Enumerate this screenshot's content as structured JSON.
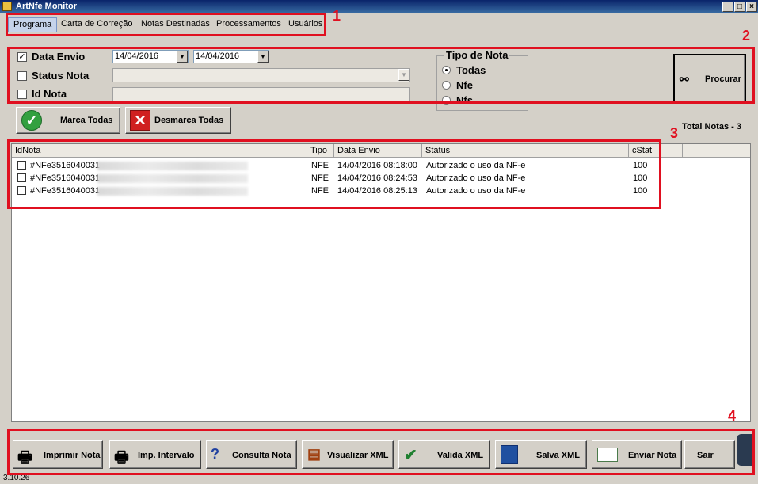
{
  "window": {
    "title": "ArtNfe Monitor"
  },
  "menu": [
    "Programa",
    "Carta de Correção",
    "Notas Destinadas",
    "Processamentos",
    "Usuários"
  ],
  "annotations": [
    "1",
    "2",
    "3",
    "4"
  ],
  "filters": {
    "data_envio": {
      "label": "Data Envio",
      "checked": true,
      "from": "14/04/2016",
      "to": "14/04/2016"
    },
    "status_nota": {
      "label": "Status Nota",
      "checked": false
    },
    "id_nota": {
      "label": "Id Nota",
      "checked": false
    },
    "tipo_nota": {
      "title": "Tipo de Nota",
      "options": [
        "Todas",
        "Nfe",
        "Nfs"
      ],
      "selected": "Todas"
    },
    "search_button": "Procurar"
  },
  "actions": {
    "mark_all": "Marca Todas",
    "unmark_all": "Desmarca Todas",
    "total": "Total Notas - 3"
  },
  "table": {
    "columns": [
      "IdNota",
      "Tipo",
      "Data Envio",
      "Status",
      "cStat"
    ],
    "rows": [
      {
        "id": "#NFe3516040031",
        "tipo": "NFE",
        "data": "14/04/2016 08:18:00",
        "status": "Autorizado o uso da NF-e",
        "cstat": "100"
      },
      {
        "id": "#NFe3516040031",
        "tipo": "NFE",
        "data": "14/04/2016 08:24:53",
        "status": "Autorizado o uso da NF-e",
        "cstat": "100"
      },
      {
        "id": "#NFe3516040031",
        "tipo": "NFE",
        "data": "14/04/2016 08:25:13",
        "status": "Autorizado o uso da NF-e",
        "cstat": "100"
      }
    ]
  },
  "toolbar": {
    "print": "Imprimir Nota",
    "print_range": "Imp. Intervalo",
    "query": "Consulta Nota",
    "view_xml": "Visualizar XML",
    "validate_xml": "Valida XML",
    "save_xml": "Salva XML",
    "send_note": "Enviar Nota",
    "exit": "Sair"
  },
  "version": "3.10.26",
  "colors": {
    "annotation": "#e01020",
    "titlebar": "#0a246a",
    "window": "#d4d0c8"
  }
}
